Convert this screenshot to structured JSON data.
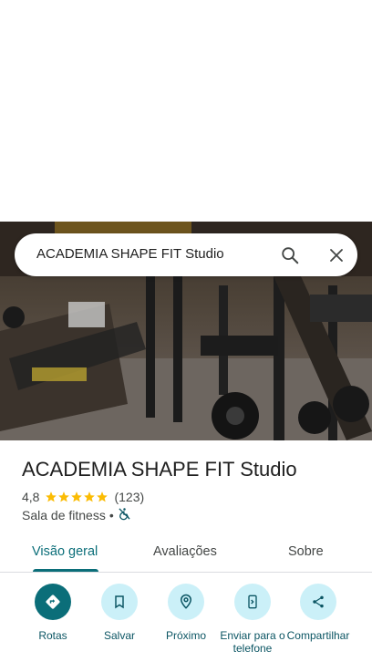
{
  "search": {
    "query": "ACADEMIA SHAPE FIT Studio"
  },
  "place": {
    "name": "ACADEMIA SHAPE FIT Studio",
    "rating": "4,8",
    "stars": 5,
    "reviews_count": "(123)",
    "category": "Sala de fitness",
    "separator": "•",
    "accessibility_icon": "wheelchair-not-accessible-icon"
  },
  "tabs": [
    {
      "label": "Visão geral",
      "active": true
    },
    {
      "label": "Avaliações",
      "active": false
    },
    {
      "label": "Sobre",
      "active": false
    }
  ],
  "actions": [
    {
      "label": "Rotas",
      "icon": "directions-icon"
    },
    {
      "label": "Salvar",
      "icon": "bookmark-icon"
    },
    {
      "label": "Próximo",
      "icon": "nearby-icon"
    },
    {
      "label": "Enviar para o telefone",
      "icon": "send-to-phone-icon"
    },
    {
      "label": "Compartilhar",
      "icon": "share-icon"
    }
  ],
  "colors": {
    "accent": "#0b6e79",
    "action_bg": "#cbf0f8",
    "star": "#fbbc04"
  }
}
